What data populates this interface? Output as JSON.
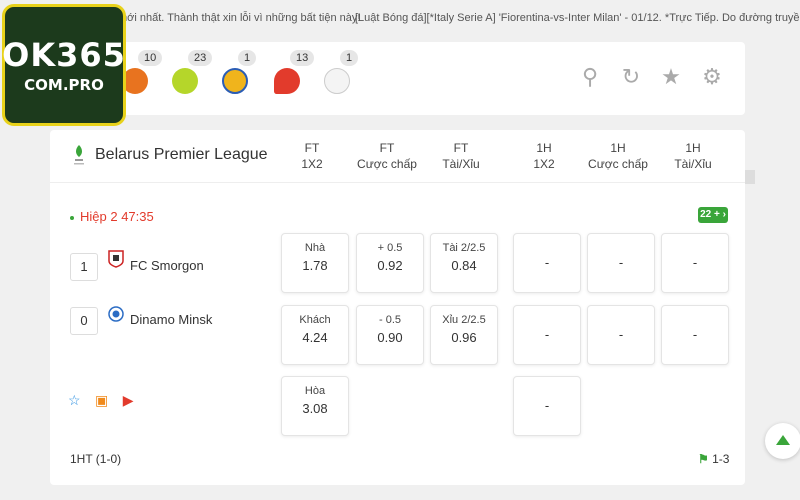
{
  "ticker": {
    "left_text": "mới nhất. Thành thật xin lỗi vì những bất tiện này!",
    "right_text": "[Luật Bóng đá][*Italy Serie A] 'Fiorentina-vs-Inter Milan' - 01/12. *Trực Tiếp. Do đường truyền gián đoạn, trận"
  },
  "logo": {
    "line1": "OK365",
    "line2": "COM.PRO"
  },
  "sports": [
    {
      "icon": "basketball-icon",
      "count": "10",
      "color": "#e8731f"
    },
    {
      "icon": "tennis-ball-icon",
      "count": "23",
      "color": "#b5d62a"
    },
    {
      "icon": "volleyball-icon",
      "count": "1",
      "color": "#f0b41c"
    },
    {
      "icon": "table-tennis-icon",
      "count": "13",
      "color": "#e23b2c"
    },
    {
      "icon": "baseball-icon",
      "count": "1",
      "color": "#eeeeee"
    }
  ],
  "tools": [
    {
      "icon": "search-icon",
      "glyph": "⚲"
    },
    {
      "icon": "refresh-icon",
      "glyph": "↻"
    },
    {
      "icon": "star-icon",
      "glyph": "★"
    },
    {
      "icon": "settings-icon",
      "glyph": "⚙"
    }
  ],
  "league": {
    "name": "Belarus Premier League",
    "columns": [
      {
        "l1": "FT",
        "l2": "1X2"
      },
      {
        "l1": "FT",
        "l2": "Cược chấp"
      },
      {
        "l1": "FT",
        "l2": "Tài/Xỉu"
      },
      {
        "l1": "1H",
        "l2": "1X2"
      },
      {
        "l1": "1H",
        "l2": "Cược chấp"
      },
      {
        "l1": "1H",
        "l2": "Tài/Xỉu"
      }
    ]
  },
  "match": {
    "status": "Hiệp 2 47:35",
    "more_markets": "22 + ›",
    "home": {
      "score": "1",
      "name": "FC Smorgon"
    },
    "away": {
      "score": "0",
      "name": "Dinamo Minsk"
    },
    "odds": {
      "home_1x2": {
        "label": "Nhà",
        "value": "1.78"
      },
      "away_1x2": {
        "label": "Khách",
        "value": "4.24"
      },
      "draw_1x2": {
        "label": "Hòa",
        "value": "3.08"
      },
      "home_hdp": {
        "label": "+ 0.5",
        "value": "0.92"
      },
      "away_hdp": {
        "label": "- 0.5",
        "value": "0.90"
      },
      "over": {
        "label": "Tài 2/2.5",
        "value": "0.84"
      },
      "under": {
        "label": "Xỉu 2/2.5",
        "value": "0.96"
      },
      "empty": "-"
    },
    "halftime": "1HT  (1-0)",
    "corners": "1-3",
    "action_icons": [
      "favorite-star-icon",
      "stats-icon",
      "live-tv-icon"
    ]
  },
  "colors": {
    "accent_green": "#3aa53a",
    "live_red": "#e23b2c"
  }
}
